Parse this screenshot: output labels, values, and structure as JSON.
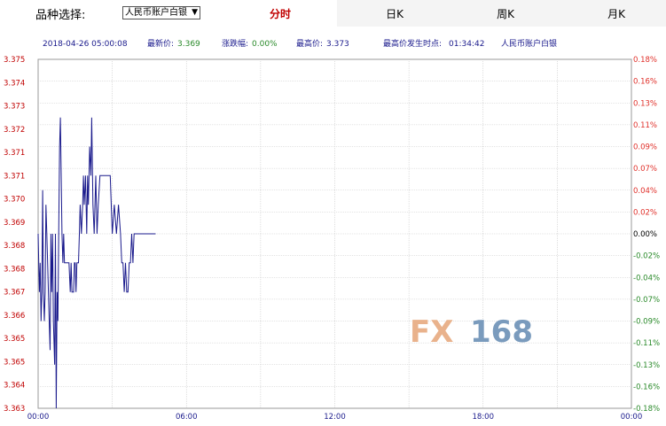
{
  "header": {
    "selector_label": "品种选择:",
    "selected_instrument": "人民币账户白银",
    "tabs": [
      {
        "label": "分时",
        "active": true
      },
      {
        "label": "日K",
        "active": false
      },
      {
        "label": "周K",
        "active": false
      },
      {
        "label": "月K",
        "active": false
      }
    ]
  },
  "info": {
    "datetime": "2018-04-26 05:00:08",
    "latest_label": "最新价:",
    "latest_value": "3.369",
    "change_label": "涨跌幅:",
    "change_value": "0.00%",
    "high_label": "最高价:",
    "high_value": "3.373",
    "high_time_label": "最高价发生时点:",
    "high_time_value": "01:34:42",
    "instrument": "人民币账户白银"
  },
  "watermark": {
    "fx": "FX",
    "num": "168"
  },
  "colors": {
    "line": "#1a1a8c",
    "up": "#e0302a",
    "down": "#2a8a2a",
    "neutral": "#000000",
    "grid": "#c8c8c8",
    "accent": "#c00000"
  },
  "chart_data": {
    "type": "line",
    "x_ticks": [
      "00:00",
      "06:00",
      "12:00",
      "18:00",
      "00:00"
    ],
    "left_ticks": [
      "3.375",
      "3.374",
      "3.373",
      "3.372",
      "3.371",
      "3.371",
      "3.370",
      "3.369",
      "3.368",
      "3.368",
      "3.367",
      "3.366",
      "3.365",
      "3.365",
      "3.364",
      "3.363"
    ],
    "right_ticks": [
      "0.18%",
      "0.16%",
      "0.13%",
      "0.11%",
      "0.09%",
      "0.07%",
      "0.04%",
      "0.02%",
      "0.00%",
      "-0.02%",
      "-0.04%",
      "-0.07%",
      "-0.09%",
      "-0.11%",
      "-0.13%",
      "-0.16%",
      "-0.18%"
    ],
    "ylim": [
      3.363,
      3.375
    ],
    "base_value": 3.369,
    "x_minutes": [
      0,
      3,
      5,
      7,
      9,
      11,
      13,
      15,
      17,
      19,
      21,
      23,
      25,
      27,
      29,
      31,
      33,
      35,
      37,
      40,
      42,
      44,
      46,
      48,
      50,
      52,
      54,
      56,
      58,
      60,
      62,
      64,
      66,
      68,
      70,
      72,
      75,
      78,
      80,
      82,
      84,
      86,
      88,
      90,
      92,
      94,
      96,
      98,
      100,
      102,
      105,
      108,
      110,
      112,
      115,
      118,
      120,
      122,
      125,
      128,
      130,
      133,
      136,
      140,
      143,
      146,
      150,
      155,
      160,
      165,
      170,
      175,
      180,
      185,
      190,
      195,
      200,
      203,
      206,
      209,
      212,
      215,
      218,
      221,
      224,
      227,
      230,
      233,
      236,
      240,
      243,
      246,
      249,
      252,
      255,
      258,
      261,
      264,
      267,
      270,
      273,
      276,
      279,
      282,
      285
    ],
    "values": [
      3.369,
      3.367,
      3.368,
      3.366,
      3.367,
      3.3705,
      3.367,
      3.366,
      3.367,
      3.37,
      3.369,
      3.368,
      3.367,
      3.366,
      3.365,
      3.369,
      3.367,
      3.369,
      3.366,
      3.3645,
      3.369,
      3.363,
      3.367,
      3.366,
      3.369,
      3.372,
      3.373,
      3.371,
      3.369,
      3.368,
      3.369,
      3.368,
      3.368,
      3.368,
      3.368,
      3.368,
      3.368,
      3.367,
      3.368,
      3.367,
      3.367,
      3.367,
      3.368,
      3.368,
      3.367,
      3.368,
      3.368,
      3.368,
      3.369,
      3.37,
      3.369,
      3.37,
      3.371,
      3.37,
      3.371,
      3.369,
      3.371,
      3.37,
      3.372,
      3.371,
      3.373,
      3.37,
      3.369,
      3.371,
      3.369,
      3.37,
      3.371,
      3.371,
      3.371,
      3.371,
      3.371,
      3.371,
      3.369,
      3.37,
      3.369,
      3.37,
      3.369,
      3.368,
      3.368,
      3.367,
      3.368,
      3.367,
      3.367,
      3.368,
      3.368,
      3.369,
      3.368,
      3.369,
      3.369,
      3.369,
      3.369,
      3.369,
      3.369,
      3.369,
      3.369,
      3.369,
      3.369,
      3.369,
      3.369,
      3.369,
      3.369,
      3.369,
      3.369,
      3.369,
      3.369
    ],
    "xlim_minutes": [
      0,
      1440
    ],
    "grid": true
  }
}
